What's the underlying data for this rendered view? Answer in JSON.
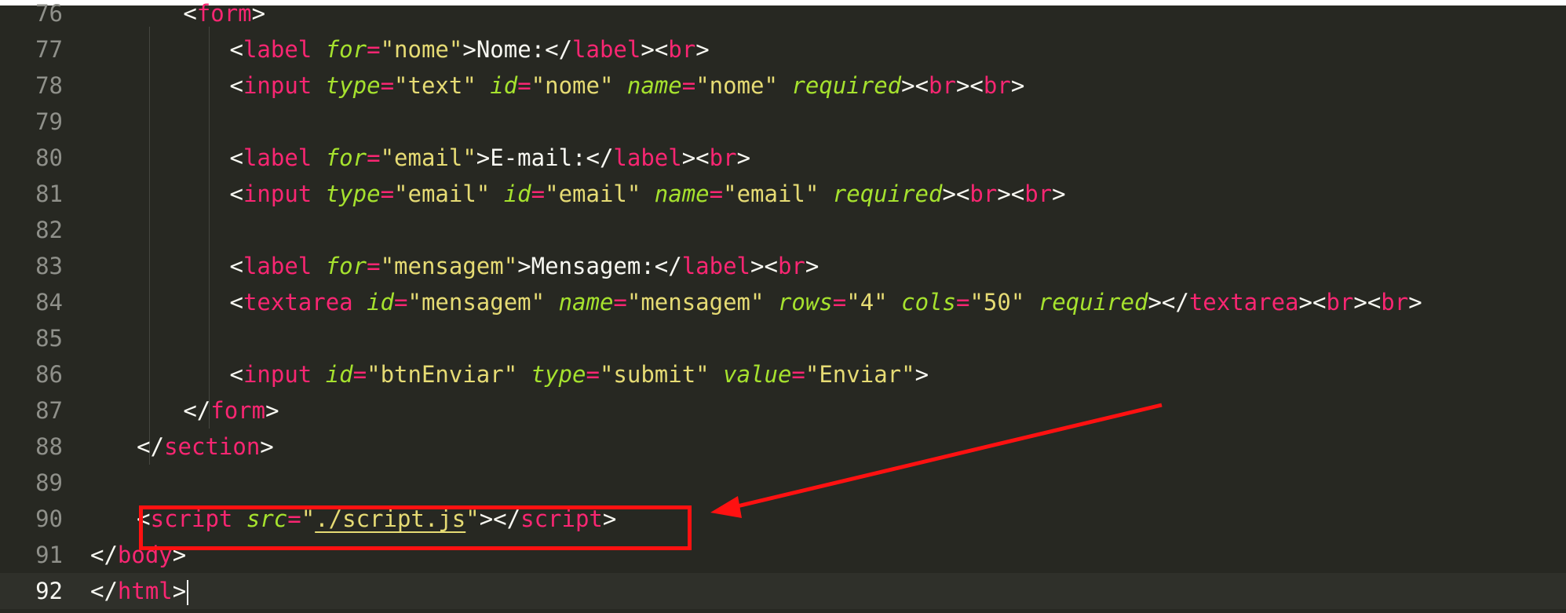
{
  "editor": {
    "accent_annotation": "#ff1111",
    "lines": [
      {
        "no": "76",
        "indent": 4,
        "tokens": [
          [
            "p",
            "<"
          ],
          [
            "tag",
            "form"
          ],
          [
            "p",
            ">"
          ]
        ]
      },
      {
        "no": "77",
        "indent": 5,
        "tokens": [
          [
            "p",
            "<"
          ],
          [
            "tag",
            "label"
          ],
          [
            "p",
            " "
          ],
          [
            "attr",
            "for"
          ],
          [
            "eq",
            "="
          ],
          [
            "str",
            "\"nome\""
          ],
          [
            "p",
            ">"
          ],
          [
            "txt",
            "Nome:"
          ],
          [
            "p",
            "</"
          ],
          [
            "tag",
            "label"
          ],
          [
            "p",
            "><"
          ],
          [
            "tag",
            "br"
          ],
          [
            "p",
            ">"
          ]
        ]
      },
      {
        "no": "78",
        "indent": 5,
        "tokens": [
          [
            "p",
            "<"
          ],
          [
            "tag",
            "input"
          ],
          [
            "p",
            " "
          ],
          [
            "attr",
            "type"
          ],
          [
            "eq",
            "="
          ],
          [
            "str",
            "\"text\""
          ],
          [
            "p",
            " "
          ],
          [
            "attr",
            "id"
          ],
          [
            "eq",
            "="
          ],
          [
            "str",
            "\"nome\""
          ],
          [
            "p",
            " "
          ],
          [
            "attr",
            "name"
          ],
          [
            "eq",
            "="
          ],
          [
            "str",
            "\"nome\""
          ],
          [
            "p",
            " "
          ],
          [
            "attr",
            "required"
          ],
          [
            "p",
            "><"
          ],
          [
            "tag",
            "br"
          ],
          [
            "p",
            "><"
          ],
          [
            "tag",
            "br"
          ],
          [
            "p",
            ">"
          ]
        ]
      },
      {
        "no": "79",
        "indent": 5,
        "tokens": []
      },
      {
        "no": "80",
        "indent": 5,
        "tokens": [
          [
            "p",
            "<"
          ],
          [
            "tag",
            "label"
          ],
          [
            "p",
            " "
          ],
          [
            "attr",
            "for"
          ],
          [
            "eq",
            "="
          ],
          [
            "str",
            "\"email\""
          ],
          [
            "p",
            ">"
          ],
          [
            "txt",
            "E-mail:"
          ],
          [
            "p",
            "</"
          ],
          [
            "tag",
            "label"
          ],
          [
            "p",
            "><"
          ],
          [
            "tag",
            "br"
          ],
          [
            "p",
            ">"
          ]
        ]
      },
      {
        "no": "81",
        "indent": 5,
        "tokens": [
          [
            "p",
            "<"
          ],
          [
            "tag",
            "input"
          ],
          [
            "p",
            " "
          ],
          [
            "attr",
            "type"
          ],
          [
            "eq",
            "="
          ],
          [
            "str",
            "\"email\""
          ],
          [
            "p",
            " "
          ],
          [
            "attr",
            "id"
          ],
          [
            "eq",
            "="
          ],
          [
            "str",
            "\"email\""
          ],
          [
            "p",
            " "
          ],
          [
            "attr",
            "name"
          ],
          [
            "eq",
            "="
          ],
          [
            "str",
            "\"email\""
          ],
          [
            "p",
            " "
          ],
          [
            "attr",
            "required"
          ],
          [
            "p",
            "><"
          ],
          [
            "tag",
            "br"
          ],
          [
            "p",
            "><"
          ],
          [
            "tag",
            "br"
          ],
          [
            "p",
            ">"
          ]
        ]
      },
      {
        "no": "82",
        "indent": 5,
        "tokens": []
      },
      {
        "no": "83",
        "indent": 5,
        "tokens": [
          [
            "p",
            "<"
          ],
          [
            "tag",
            "label"
          ],
          [
            "p",
            " "
          ],
          [
            "attr",
            "for"
          ],
          [
            "eq",
            "="
          ],
          [
            "str",
            "\"mensagem\""
          ],
          [
            "p",
            ">"
          ],
          [
            "txt",
            "Mensagem:"
          ],
          [
            "p",
            "</"
          ],
          [
            "tag",
            "label"
          ],
          [
            "p",
            "><"
          ],
          [
            "tag",
            "br"
          ],
          [
            "p",
            ">"
          ]
        ]
      },
      {
        "no": "84",
        "indent": 5,
        "tokens": [
          [
            "p",
            "<"
          ],
          [
            "tag",
            "textarea"
          ],
          [
            "p",
            " "
          ],
          [
            "attr",
            "id"
          ],
          [
            "eq",
            "="
          ],
          [
            "str",
            "\"mensagem\""
          ],
          [
            "p",
            " "
          ],
          [
            "attr",
            "name"
          ],
          [
            "eq",
            "="
          ],
          [
            "str",
            "\"mensagem\""
          ],
          [
            "p",
            " "
          ],
          [
            "attr",
            "rows"
          ],
          [
            "eq",
            "="
          ],
          [
            "str",
            "\"4\""
          ],
          [
            "p",
            " "
          ],
          [
            "attr",
            "cols"
          ],
          [
            "eq",
            "="
          ],
          [
            "str",
            "\"50\""
          ],
          [
            "p",
            " "
          ],
          [
            "attr",
            "required"
          ],
          [
            "p",
            "></"
          ],
          [
            "tag",
            "textarea"
          ],
          [
            "p",
            "><"
          ],
          [
            "tag",
            "br"
          ],
          [
            "p",
            "><"
          ],
          [
            "tag",
            "br"
          ],
          [
            "p",
            ">"
          ]
        ]
      },
      {
        "no": "85",
        "indent": 5,
        "tokens": []
      },
      {
        "no": "86",
        "indent": 5,
        "tokens": [
          [
            "p",
            "<"
          ],
          [
            "tag",
            "input"
          ],
          [
            "p",
            " "
          ],
          [
            "attr",
            "id"
          ],
          [
            "eq",
            "="
          ],
          [
            "str",
            "\"btnEnviar\""
          ],
          [
            "p",
            " "
          ],
          [
            "attr",
            "type"
          ],
          [
            "eq",
            "="
          ],
          [
            "str",
            "\"submit\""
          ],
          [
            "p",
            " "
          ],
          [
            "attr",
            "value"
          ],
          [
            "eq",
            "="
          ],
          [
            "str",
            "\"Enviar\""
          ],
          [
            "p",
            ">"
          ]
        ]
      },
      {
        "no": "87",
        "indent": 4,
        "tokens": [
          [
            "p",
            "</"
          ],
          [
            "tag",
            "form"
          ],
          [
            "p",
            ">"
          ]
        ]
      },
      {
        "no": "88",
        "indent": 3,
        "tokens": [
          [
            "p",
            "</"
          ],
          [
            "tag",
            "section"
          ],
          [
            "p",
            ">"
          ]
        ]
      },
      {
        "no": "89",
        "indent": 3,
        "tokens": []
      },
      {
        "no": "90",
        "indent": 3,
        "tokens": [
          [
            "p",
            "<"
          ],
          [
            "tag",
            "script"
          ],
          [
            "p",
            " "
          ],
          [
            "attr",
            "src"
          ],
          [
            "eq",
            "="
          ],
          [
            "str",
            "\""
          ],
          [
            "str-u",
            "./script.js"
          ],
          [
            "str",
            "\""
          ],
          [
            "p",
            "></"
          ],
          [
            "tag",
            "script"
          ],
          [
            "p",
            ">"
          ]
        ]
      },
      {
        "no": "91",
        "indent": 2,
        "tokens": [
          [
            "p",
            "</"
          ],
          [
            "tag",
            "body"
          ],
          [
            "p",
            ">"
          ]
        ]
      },
      {
        "no": "92",
        "indent": 2,
        "tokens": [
          [
            "p",
            "</"
          ],
          [
            "tag",
            "html"
          ],
          [
            "p",
            ">"
          ]
        ],
        "current": true,
        "caret": true
      }
    ]
  }
}
